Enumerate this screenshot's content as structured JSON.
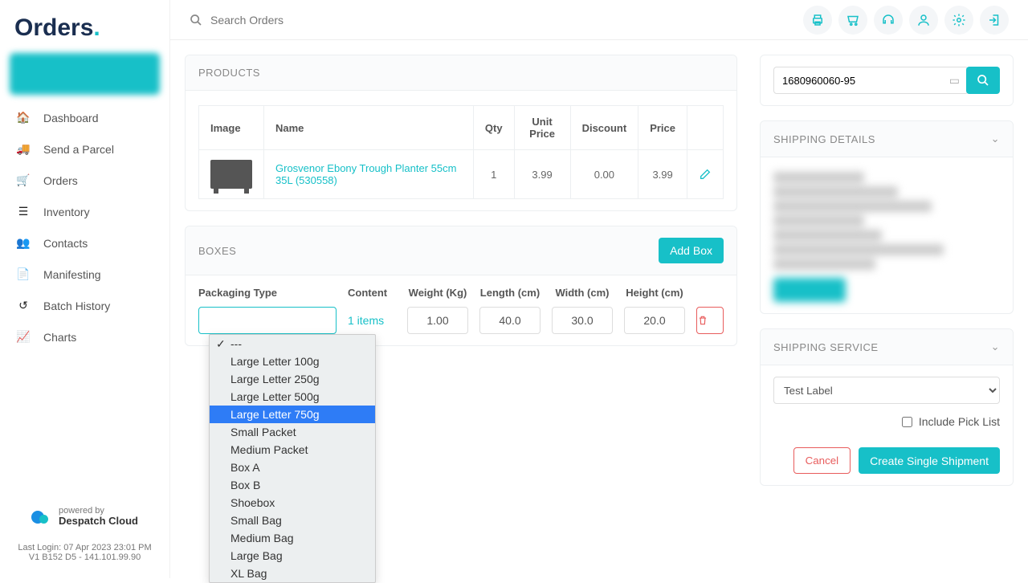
{
  "logo": {
    "text": "Orders",
    "dot": "."
  },
  "sidebar": {
    "items": [
      {
        "label": "Dashboard",
        "icon": "home"
      },
      {
        "label": "Send a Parcel",
        "icon": "truck"
      },
      {
        "label": "Orders",
        "icon": "cart"
      },
      {
        "label": "Inventory",
        "icon": "list"
      },
      {
        "label": "Contacts",
        "icon": "users"
      },
      {
        "label": "Manifesting",
        "icon": "doc"
      },
      {
        "label": "Batch History",
        "icon": "history"
      },
      {
        "label": "Charts",
        "icon": "chart"
      }
    ]
  },
  "footer": {
    "powered_by": "powered by",
    "brand": "Despatch Cloud",
    "last_login": "Last Login: 07 Apr 2023 23:01 PM",
    "version": "V1 B152 D5 - 141.101.99.90"
  },
  "search": {
    "placeholder": "Search Orders"
  },
  "products": {
    "heading": "PRODUCTS",
    "columns": {
      "image": "Image",
      "name": "Name",
      "qty": "Qty",
      "unit_price": "Unit Price",
      "discount": "Discount",
      "price": "Price"
    },
    "rows": [
      {
        "name": "Grosvenor Ebony Trough Planter 55cm 35L (530558)",
        "qty": "1",
        "unit_price": "3.99",
        "discount": "0.00",
        "price": "3.99"
      }
    ]
  },
  "boxes": {
    "heading": "BOXES",
    "add_label": "Add Box",
    "columns": {
      "packaging": "Packaging Type",
      "content": "Content",
      "weight": "Weight (Kg)",
      "length": "Length (cm)",
      "width": "Width (cm)",
      "height": "Height (cm)"
    },
    "row": {
      "content": "1 items",
      "weight": "1.00",
      "length": "40.0",
      "width": "30.0",
      "height": "20.0"
    },
    "packaging_options": [
      "---",
      "Large Letter 100g",
      "Large Letter 250g",
      "Large Letter 500g",
      "Large Letter 750g",
      "Small Packet",
      "Medium Packet",
      "Box A",
      "Box B",
      "Shoebox",
      "Small Bag",
      "Medium Bag",
      "Large Bag",
      "XL Bag"
    ],
    "packaging_selected": "---",
    "packaging_highlighted": "Large Letter 750g"
  },
  "order_search": {
    "value": "1680960060-95"
  },
  "shipping_details": {
    "heading": "SHIPPING DETAILS"
  },
  "shipping_service": {
    "heading": "SHIPPING SERVICE",
    "selected": "Test Label",
    "include_pick": "Include Pick List",
    "cancel": "Cancel",
    "create": "Create Single Shipment"
  }
}
